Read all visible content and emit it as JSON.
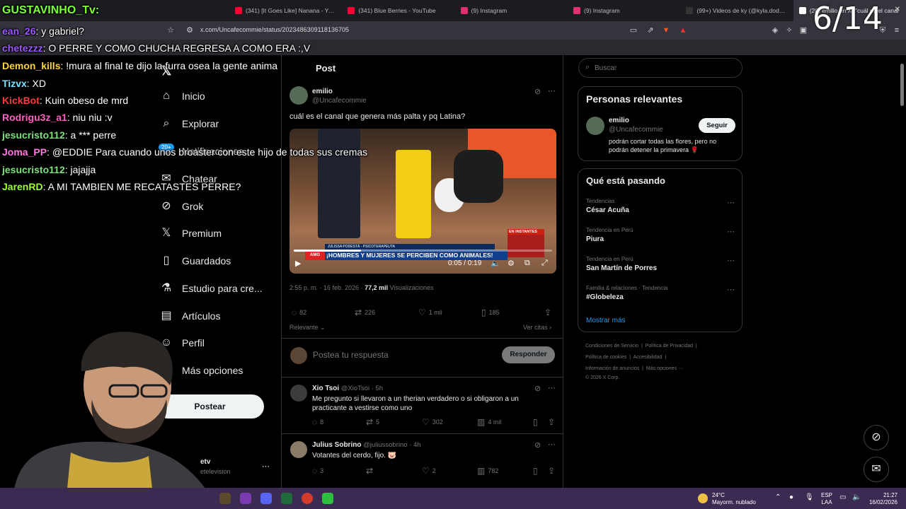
{
  "browser": {
    "tabs": [
      {
        "title": "(341) [It Goes Like] Nanana - YouTube",
        "color": "#ff0033"
      },
      {
        "title": "(341) Blue Berries - YouTube",
        "color": "#ff0033"
      },
      {
        "title": "(9) Instagram",
        "color": "#e1306c"
      },
      {
        "title": "(9) Instagram",
        "color": "#e1306c"
      },
      {
        "title": "(99+) Videos de ky (@kyla.dodds) con",
        "color": "#222222"
      },
      {
        "title": "(20) emilio en X: \"cuál es el canal",
        "color": "#ffffff"
      }
    ],
    "url": "x.com/Uncafecommie/status/2023486309118136705"
  },
  "overlay": {
    "counter": "6/14",
    "chat": [
      {
        "user": "GUSTAVINHO_Tv:",
        "msg": "",
        "color": "#7fff3a"
      },
      {
        "user": "ean_26",
        "msg": ": y gabriel?",
        "color": "#9b59ff"
      },
      {
        "user": "chetezzz",
        "msg": ": O PERRE Y COMO CHUCHA REGRESA A COMO ERA :,V",
        "color": "#9b59ff"
      },
      {
        "user": "Demon_kills",
        "msg": ": !mura al final te dijo la furra osea la gente anima",
        "color": "#ffd23a"
      },
      {
        "user": "Tizvx",
        "msg": ": XD",
        "color": "#7fe0ff"
      },
      {
        "user": "KickBot",
        "msg": ": Kuin obeso de mrd",
        "color": "#ff3a3a"
      },
      {
        "user": "Rodrigu3z_a1",
        "msg": ": niu niu :v",
        "color": "#ff5fbf"
      },
      {
        "user": "jesucristo112",
        "msg": ": a *** perre",
        "color": "#7fe07f"
      },
      {
        "user": "Joma_PP",
        "msg": ": @EDDIE Para cuando unos broaster con este hijo de todas sus cremas",
        "color": "#ff7ae0"
      },
      {
        "user": "jesucristo112",
        "msg": ": jajajja",
        "color": "#7fe07f"
      },
      {
        "user": "JarenRD",
        "msg": ": A MI TAMBIEN ME RECATASTES PERRE?",
        "color": "#9cff3a"
      }
    ]
  },
  "nav": {
    "items": [
      {
        "label": "Inicio",
        "icon": "home-icon"
      },
      {
        "label": "Explorar",
        "icon": "search-icon"
      },
      {
        "label": "Notificaciones",
        "icon": "bell-icon"
      },
      {
        "label": "Chatear",
        "icon": "mail-icon"
      },
      {
        "label": "Grok",
        "icon": "grok-icon"
      },
      {
        "label": "Premium",
        "icon": "x-logo-icon"
      },
      {
        "label": "Guardados",
        "icon": "bookmark-icon"
      },
      {
        "label": "Estudio para cre...",
        "icon": "studio-icon"
      },
      {
        "label": "Artículos",
        "icon": "article-icon"
      },
      {
        "label": "Perfil",
        "icon": "person-icon"
      },
      {
        "label": "Más opciones",
        "icon": "more-icon"
      }
    ],
    "notif_badge": "20+",
    "post_button": "Postear",
    "account_name": "etv",
    "account_handle": "etelevision"
  },
  "main": {
    "header": "Post",
    "tweet": {
      "name": "emilio",
      "handle": "@Uncafecommie",
      "text": "cuál es el canal que genera más palta y pq Latina?",
      "video_time": "0:05 / 0:19",
      "video_banner": "¡HOMBRES Y MUJERES SE PERCIBEN COMO ANIMALES!",
      "video_subtitle": "JULISSA PODESTÁ - PSICOTERAPEUTA",
      "video_tag": "EN INSTANTES",
      "timestamp": "2:55 p. m. · 16 feb. 2026 · ",
      "views": "77,2 mil",
      "views_label": " Visualizaciones",
      "replies": "82",
      "reposts": "226",
      "likes": "1 mil",
      "bookmarks": "185",
      "sort_label": "Relevante",
      "quotes_label": "Ver citas"
    },
    "reply_placeholder": "Postea tu respuesta",
    "reply_button": "Responder",
    "replies": [
      {
        "name": "Xio Tsoi",
        "handle": "@XioTsoi",
        "time": "· 5h",
        "text": "Me pregunto si llevaron a un therian verdadero o si obligaron a un practicante a vestirse como uno",
        "replies": "8",
        "reposts": "5",
        "likes": "302",
        "views": "4 mil"
      },
      {
        "name": "Julius Sobrino",
        "handle": "@juliussobrino",
        "time": "· 4h",
        "text": "Votantes del cerdo, fijo. 🐷",
        "replies": "3",
        "reposts": "",
        "likes": "2",
        "views": "782"
      }
    ]
  },
  "right": {
    "search_placeholder": "Buscar",
    "relevant_title": "Personas relevantes",
    "relevant_user": {
      "name": "emilio",
      "handle": "@Uncafecommie",
      "bio": "podrán cortar todas las flores, pero no podrán detener la primavera 🌹",
      "follow": "Seguir"
    },
    "trending_title": "Qué está pasando",
    "trends": [
      {
        "category": "Tendencias",
        "name": "César Acuña"
      },
      {
        "category": "Tendencia en Perú",
        "name": "Piura"
      },
      {
        "category": "Tendencia en Perú",
        "name": "San Martín de Porres"
      },
      {
        "category": "Familia & relaciones · Tendencia",
        "name": "#Globeleza"
      }
    ],
    "show_more": "Mostrar más",
    "footer": [
      "Condiciones de Servicio",
      "Política de Privacidad",
      "Política de cookies",
      "Accesibilidad",
      "Información de anuncios",
      "Más opciones ···",
      "© 2026 X Corp."
    ]
  },
  "taskbar": {
    "weather_temp": "24°C",
    "weather_desc": "Mayorm. nublado",
    "lang1": "ESP",
    "lang2": "LAA",
    "time": "21:27",
    "date": "16/02/2026"
  }
}
